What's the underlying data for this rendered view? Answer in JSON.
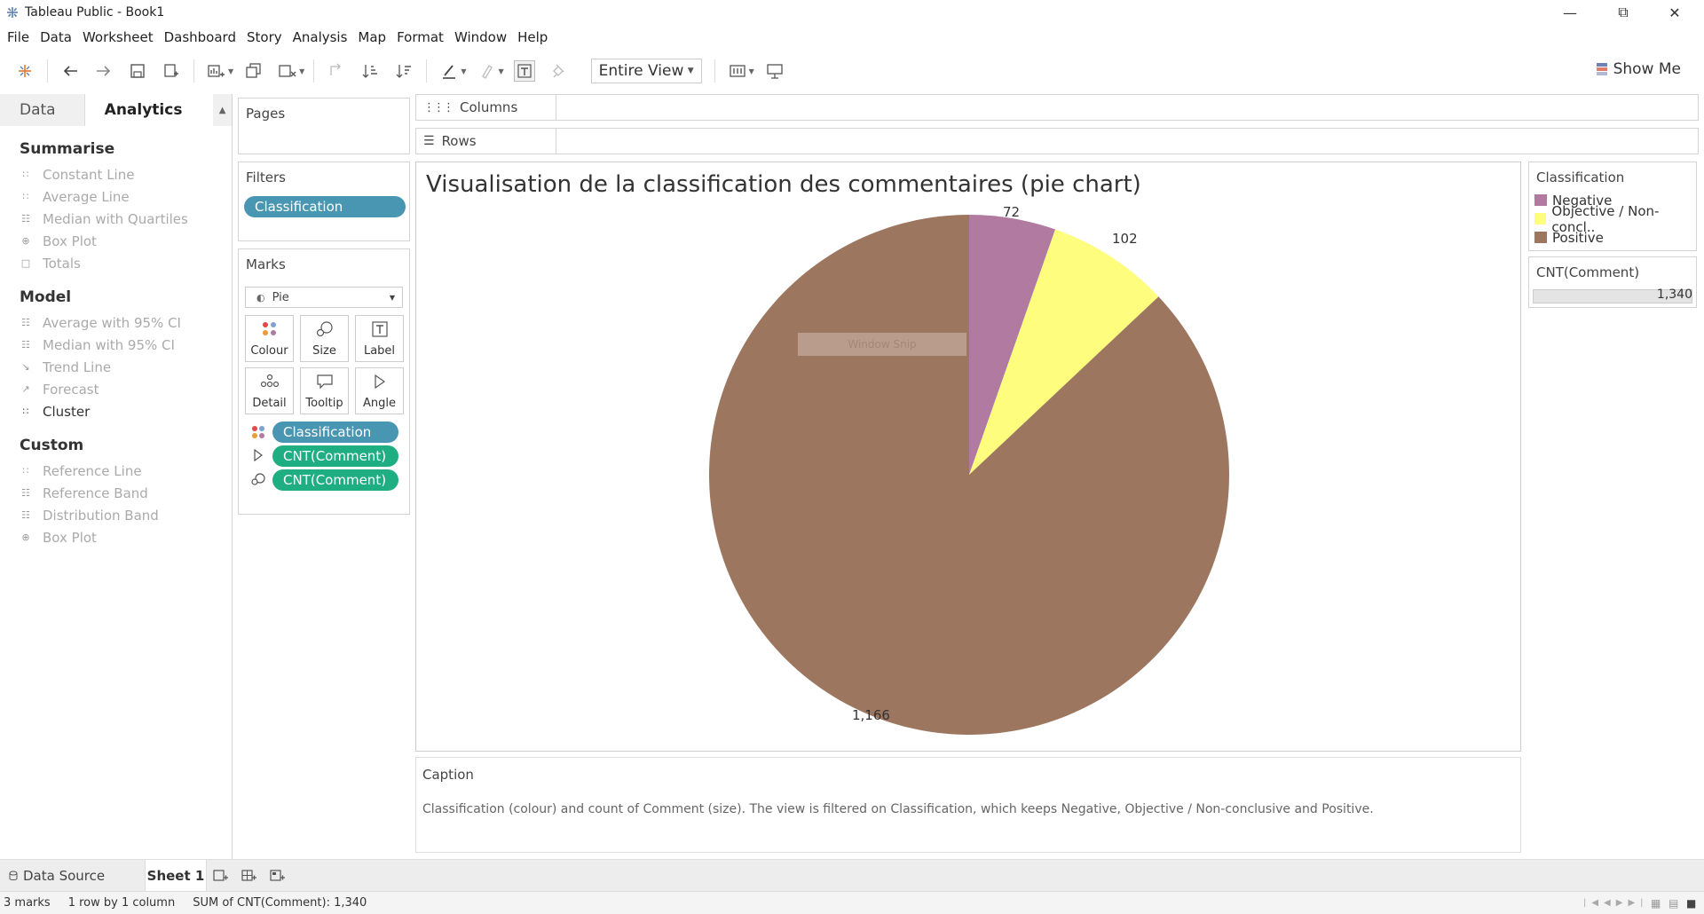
{
  "window": {
    "title": "Tableau Public - Book1"
  },
  "menu": [
    "File",
    "Data",
    "Worksheet",
    "Dashboard",
    "Story",
    "Analysis",
    "Map",
    "Format",
    "Window",
    "Help"
  ],
  "toolbar": {
    "fit_value": "Entire View",
    "show_me": "Show Me"
  },
  "sidebar": {
    "tabs": {
      "data": "Data",
      "analytics": "Analytics"
    },
    "sections": [
      {
        "title": "Summarise",
        "items": [
          {
            "label": "Constant Line",
            "icon": "constant-line-icon",
            "active": false
          },
          {
            "label": "Average Line",
            "icon": "average-line-icon",
            "active": false
          },
          {
            "label": "Median with Quartiles",
            "icon": "median-quartiles-icon",
            "active": false
          },
          {
            "label": "Box Plot",
            "icon": "box-plot-icon",
            "active": false
          },
          {
            "label": "Totals",
            "icon": "totals-icon",
            "active": false
          }
        ]
      },
      {
        "title": "Model",
        "items": [
          {
            "label": "Average with 95% CI",
            "icon": "average-ci-icon",
            "active": false
          },
          {
            "label": "Median with 95% CI",
            "icon": "median-ci-icon",
            "active": false
          },
          {
            "label": "Trend Line",
            "icon": "trend-line-icon",
            "active": false
          },
          {
            "label": "Forecast",
            "icon": "forecast-icon",
            "active": false
          },
          {
            "label": "Cluster",
            "icon": "cluster-icon",
            "active": true
          }
        ]
      },
      {
        "title": "Custom",
        "items": [
          {
            "label": "Reference Line",
            "icon": "reference-line-icon",
            "active": false
          },
          {
            "label": "Reference Band",
            "icon": "reference-band-icon",
            "active": false
          },
          {
            "label": "Distribution Band",
            "icon": "distribution-band-icon",
            "active": false
          },
          {
            "label": "Box Plot",
            "icon": "box-plot-icon",
            "active": false
          }
        ]
      }
    ]
  },
  "pages": {
    "title": "Pages"
  },
  "filters": {
    "title": "Filters",
    "pill": "Classification"
  },
  "marks": {
    "title": "Marks",
    "type": "Pie",
    "buttons": [
      "Colour",
      "Size",
      "Label",
      "Detail",
      "Tooltip",
      "Angle"
    ],
    "pills": [
      "Classification",
      "CNT(Comment)",
      "CNT(Comment)"
    ]
  },
  "shelves": {
    "columns": "Columns",
    "rows": "Rows"
  },
  "view": {
    "title": "Visualisation de la classification des commentaires (pie chart)",
    "watermark": "Window Snip"
  },
  "chart_data": {
    "type": "pie",
    "title": "Visualisation de la classification des commentaires (pie chart)",
    "categories": [
      "Negative",
      "Objective / Non-concl..",
      "Positive"
    ],
    "values": [
      72,
      102,
      1166
    ],
    "labels": [
      "72",
      "102",
      "1,166"
    ],
    "colors": [
      "#b07aa1",
      "#fffd7d",
      "#9d7660"
    ],
    "total": 1340
  },
  "caption": {
    "title": "Caption",
    "text": "Classification (colour) and count of Comment (size). The view is filtered on Classification, which keeps Negative, Objective / Non-conclusive and Positive."
  },
  "legend": {
    "title": "Classification",
    "items": [
      "Negative",
      "Objective / Non-concl..",
      "Positive"
    ],
    "colors": [
      "#b07aa1",
      "#fffd7d",
      "#9d7660"
    ]
  },
  "size_legend": {
    "title": "CNT(Comment)",
    "value": "1,340"
  },
  "sheetbar": {
    "data_source": "Data Source",
    "sheet": "Sheet 1"
  },
  "status": {
    "marks": "3 marks",
    "dims": "1 row by 1 column",
    "sum": "SUM of CNT(Comment): 1,340"
  },
  "accent": {
    "blue_pill": "#4996b2",
    "green_pill": "#1fae81"
  }
}
